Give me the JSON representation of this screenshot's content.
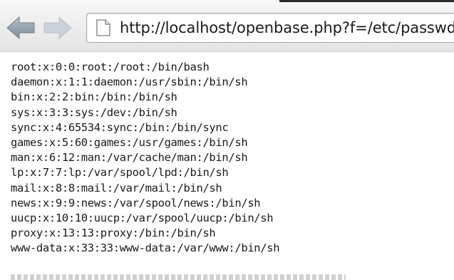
{
  "browser": {
    "back_icon": "arrow-left-icon",
    "forward_icon": "arrow-right-icon",
    "page_icon": "document-icon",
    "address": {
      "url": "http://localhost/openbase.php?f=/etc/passwd"
    },
    "colors": {
      "toolbar": "#ececec",
      "back_arrow": "#8f9ba9",
      "forward_arrow": "#c3cad3"
    }
  },
  "content": {
    "lines": [
      "root:x:0:0:root:/root:/bin/bash",
      "daemon:x:1:1:daemon:/usr/sbin:/bin/sh",
      "bin:x:2:2:bin:/bin:/bin/sh",
      "sys:x:3:3:sys:/dev:/bin/sh",
      "sync:x:4:65534:sync:/bin:/bin/sync",
      "games:x:5:60:games:/usr/games:/bin/sh",
      "man:x:6:12:man:/var/cache/man:/bin/sh",
      "lp:x:7:7:lp:/var/spool/lpd:/bin/sh",
      "mail:x:8:8:mail:/var/mail:/bin/sh",
      "news:x:9:9:news:/var/spool/news:/bin/sh",
      "uucp:x:10:10:uucp:/var/spool/uucp:/bin/sh",
      "proxy:x:13:13:proxy:/bin:/bin/sh",
      "www-data:x:33:33:www-data:/var/www:/bin/sh"
    ]
  }
}
